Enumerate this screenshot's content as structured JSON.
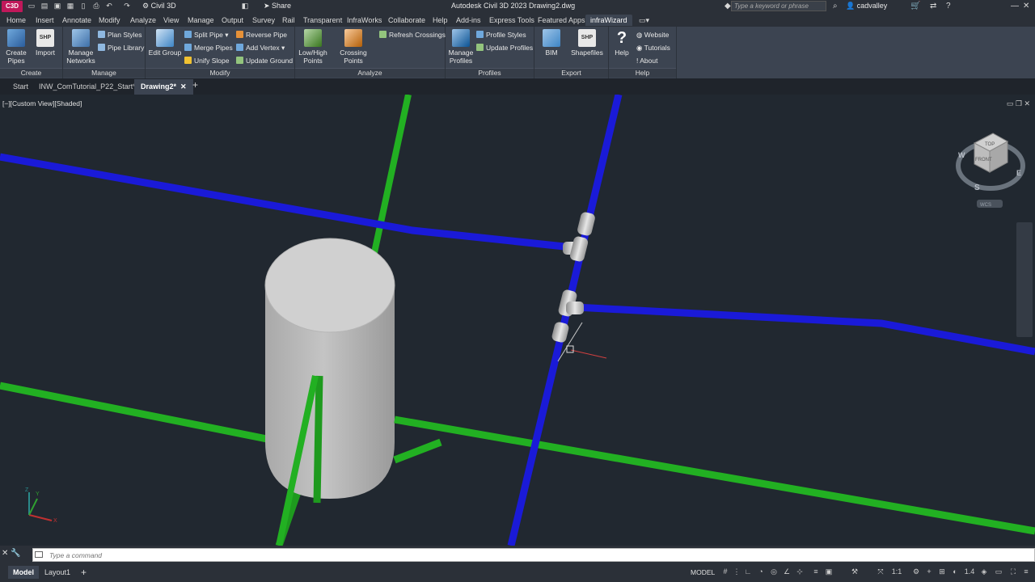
{
  "app": {
    "logo_text": "C3D",
    "workspace": "Civil 3D",
    "share": "Share",
    "title": "Autodesk Civil 3D 2023    Drawing2.dwg",
    "search_placeholder": "Type a keyword or phrase",
    "user": "cadvalley"
  },
  "tabs": [
    "Home",
    "Insert",
    "Annotate",
    "Modify",
    "Analyze",
    "View",
    "Manage",
    "Output",
    "Survey",
    "Rail",
    "Transparent",
    "InfraWorks",
    "Collaborate",
    "Help",
    "Add-ins",
    "Express Tools",
    "Featured Apps",
    "infraWizard"
  ],
  "active_tab": "infraWizard",
  "ribbon": {
    "create": {
      "title": "Create",
      "create_pipes": "Create Pipes",
      "import": "Import",
      "import_badge": "SHP"
    },
    "manage": {
      "title": "Manage",
      "manage_networks": "Manage Networks",
      "plan_styles": "Plan Styles",
      "pipe_library": "Pipe Library"
    },
    "modify": {
      "title": "Modify",
      "edit_group": "Edit Group",
      "split_pipe": "Split Pipe",
      "merge_pipes": "Merge Pipes",
      "unify_slope": "Unify Slope",
      "reverse_pipe": "Reverse Pipe",
      "add_vertex": "Add Vertex",
      "update_ground": "Update Ground"
    },
    "analyze": {
      "title": "Analyze",
      "low_high_points": "Low/High Points",
      "crossing_points": "Crossing Points",
      "refresh_crossings": "Refresh Crossings"
    },
    "profiles": {
      "title": "Profiles",
      "manage_profiles": "Manage Profiles",
      "profile_styles": "Profile Styles",
      "update_profiles": "Update Profiles"
    },
    "export": {
      "title": "Export",
      "bim": "BIM",
      "shapefiles": "Shapefiles",
      "shp_badge": "SHP"
    },
    "help": {
      "title": "Help",
      "help": "Help",
      "website": "Website",
      "tutorials": "Tutorials",
      "about": "About"
    }
  },
  "file_tabs": {
    "start": "Start",
    "tut": "INW_ComTutorial_P22_Start*",
    "drawing": "Drawing2*"
  },
  "viewport": {
    "label": "[−][Custom View][Shaded]",
    "viewcube": {
      "top": "TOP",
      "front": "FRONT",
      "w": "W",
      "s": "S",
      "e": "E",
      "wcs": "WCS"
    },
    "ucs": {
      "x": "X",
      "y": "Y",
      "z": "Z"
    }
  },
  "command": {
    "placeholder": "Type a command"
  },
  "status": {
    "model_tab": "Model",
    "layout_tab": "Layout1",
    "model_button": "MODEL",
    "scale": "1:1",
    "zoom": "1.4"
  },
  "colors": {
    "pipe_blue": "#1a1ad8",
    "pipe_green": "#22b022",
    "structure": "#b8b8b8"
  }
}
